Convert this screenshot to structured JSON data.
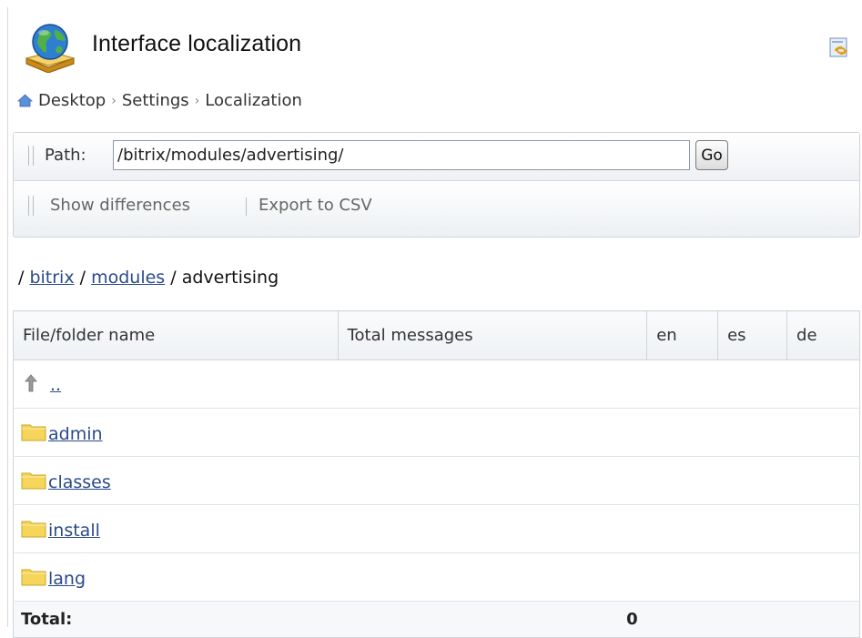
{
  "header": {
    "title": "Interface localization",
    "globe_icon": "globe-book-icon",
    "link_icon": "link-icon"
  },
  "breadcrumb": {
    "items": [
      "Desktop",
      "Settings",
      "Localization"
    ],
    "separator": "›",
    "home_icon": "home-icon"
  },
  "toolbar": {
    "path_label": "Path:",
    "path_value": "/bitrix/modules/advertising/",
    "go_label": "Go",
    "show_differences_label": "Show differences",
    "export_csv_label": "Export to CSV"
  },
  "current_path": {
    "root_sep": "/",
    "parts": [
      "bitrix",
      "modules",
      "advertising"
    ],
    "sep": "/"
  },
  "table": {
    "columns": [
      "File/folder name",
      "Total messages",
      "en",
      "es",
      "de"
    ],
    "up_link": "..",
    "rows": [
      {
        "name": "admin",
        "icon": "folder-icon"
      },
      {
        "name": "classes",
        "icon": "folder-icon"
      },
      {
        "name": "install",
        "icon": "folder-icon"
      },
      {
        "name": "lang",
        "icon": "folder-icon"
      }
    ],
    "total_label": "Total:",
    "total_value": "0"
  },
  "colors": {
    "link": "#2a4a8a",
    "border": "#d0d5db",
    "folder": "#f5d65a"
  }
}
